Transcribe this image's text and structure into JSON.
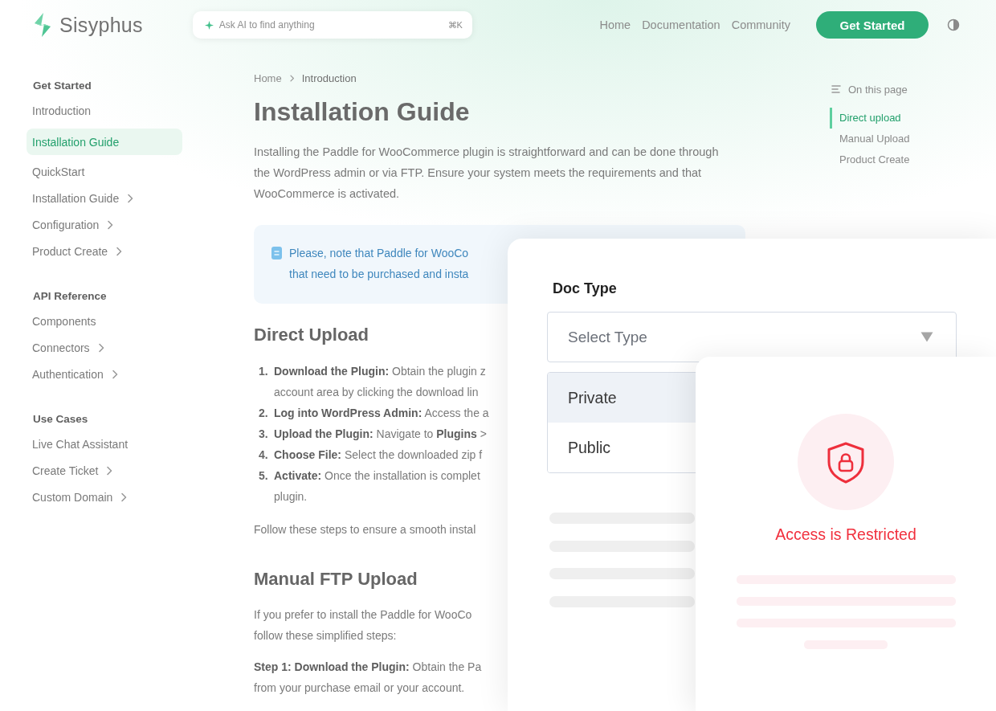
{
  "header": {
    "logo": "Sisyphus",
    "search": {
      "placeholder": "Ask AI to find anything",
      "shortcut": "⌘K"
    },
    "nav": [
      "Home",
      "Documentation",
      "Community"
    ],
    "cta": "Get Started"
  },
  "sidebar": {
    "groups": [
      {
        "title": "Get Started",
        "items": [
          {
            "label": "Introduction",
            "selected": false,
            "expandable": false
          },
          {
            "label": "Installation Guide",
            "selected": true,
            "expandable": false
          },
          {
            "label": "QuickStart",
            "selected": false,
            "expandable": false
          },
          {
            "label": "Installation Guide",
            "selected": false,
            "expandable": true
          },
          {
            "label": "Configuration",
            "selected": false,
            "expandable": true
          },
          {
            "label": "Product Create",
            "selected": false,
            "expandable": true
          }
        ]
      },
      {
        "title": "API Reference",
        "items": [
          {
            "label": "Components",
            "selected": false,
            "expandable": false
          },
          {
            "label": "Connectors",
            "selected": false,
            "expandable": true
          },
          {
            "label": "Authentication",
            "selected": false,
            "expandable": true
          }
        ]
      },
      {
        "title": "Use Cases",
        "items": [
          {
            "label": "Live Chat Assistant",
            "selected": false,
            "expandable": false
          },
          {
            "label": "Create Ticket",
            "selected": false,
            "expandable": true
          },
          {
            "label": "Custom Domain",
            "selected": false,
            "expandable": true
          }
        ]
      }
    ]
  },
  "breadcrumb": [
    "Home",
    "Introduction"
  ],
  "article": {
    "title": "Installation Guide",
    "intro": "Installing the Paddle for WooCommerce plugin is straightforward and can be done through the WordPress admin or via FTP. Ensure your system meets the requirements and that WooCommerce is activated.",
    "note": [
      "Please, note that Paddle for WooCo",
      "that need to be purchased and insta"
    ],
    "sections": [
      {
        "heading": "Direct Upload",
        "steps": [
          {
            "number": "1.",
            "lines": [
              "**Download the Plugin:** Obtain the plugin z",
              "account area by clicking the download lin"
            ]
          },
          {
            "number": "2.",
            "lines": [
              "**Log into WordPress Admin:** Access the a"
            ]
          },
          {
            "number": "3.",
            "lines": [
              "**Upload the Plugin:** Navigate to **Plugins** >"
            ]
          },
          {
            "number": "4.",
            "lines": [
              "**Choose File:** Select the downloaded zip f"
            ]
          },
          {
            "number": "5.",
            "lines": [
              "**Activate:** Once the installation is complet",
              "plugin."
            ]
          }
        ],
        "paragraphs": [
          [
            "Follow these steps to ensure a smooth instal"
          ]
        ]
      },
      {
        "heading": "Manual FTP Upload",
        "paragraphs": [
          [
            "If you prefer to install the Paddle for WooCo",
            "follow these simplified steps:"
          ],
          [
            "**Step 1: Download the Plugin:** Obtain the Pa",
            "from your purchase email or your account."
          ]
        ]
      }
    ]
  },
  "toc": {
    "title": "On this page",
    "items": [
      {
        "label": "Direct upload",
        "selected": true
      },
      {
        "label": "Manual Upload",
        "selected": false
      },
      {
        "label": "Product Create",
        "selected": false
      }
    ]
  },
  "doc_type": {
    "label": "Doc Type",
    "select": {
      "placeholder": "Select Type"
    },
    "options": [
      {
        "label": "Private",
        "selected": true
      },
      {
        "label": "Public",
        "selected": false
      }
    ]
  },
  "restricted": {
    "message": "Access is Restricted"
  }
}
